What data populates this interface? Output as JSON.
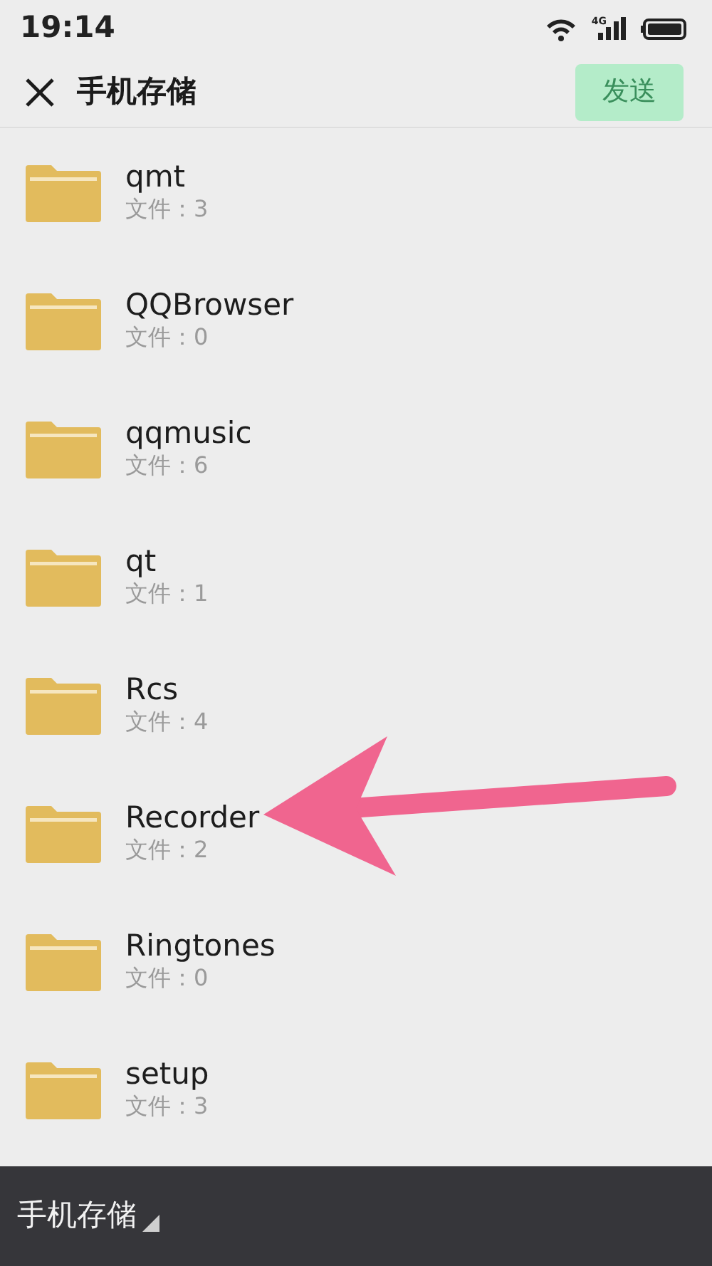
{
  "status_bar": {
    "time": "19:14",
    "network": "4G"
  },
  "header": {
    "title": "手机存储",
    "send_button": {
      "label": "发送",
      "disabled": true
    }
  },
  "folders": [
    {
      "name": "qmt",
      "count_label": "文件：3"
    },
    {
      "name": "QQBrowser",
      "count_label": "文件：0"
    },
    {
      "name": "qqmusic",
      "count_label": "文件：6"
    },
    {
      "name": "qt",
      "count_label": "文件：1"
    },
    {
      "name": "Rcs",
      "count_label": "文件：4"
    },
    {
      "name": "Recorder",
      "count_label": "文件：2"
    },
    {
      "name": "Ringtones",
      "count_label": "文件：0"
    },
    {
      "name": "setup",
      "count_label": "文件：3"
    }
  ],
  "bottom_bar": {
    "storage_selector": "手机存储"
  }
}
